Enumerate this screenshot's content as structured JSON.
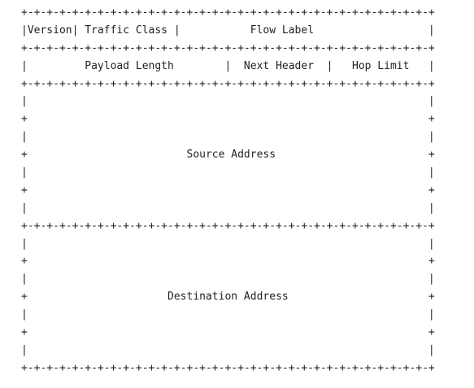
{
  "header_diagram": {
    "lines": [
      "+-+-+-+-+-+-+-+-+-+-+-+-+-+-+-+-+-+-+-+-+-+-+-+-+-+-+-+-+-+-+-+-+",
      "|Version| Traffic Class |           Flow Label                  |",
      "+-+-+-+-+-+-+-+-+-+-+-+-+-+-+-+-+-+-+-+-+-+-+-+-+-+-+-+-+-+-+-+-+",
      "|         Payload Length        |  Next Header  |   Hop Limit   |",
      "+-+-+-+-+-+-+-+-+-+-+-+-+-+-+-+-+-+-+-+-+-+-+-+-+-+-+-+-+-+-+-+-+",
      "|                                                               |",
      "+                                                               +",
      "|                                                               |",
      "+                         Source Address                        +",
      "|                                                               |",
      "+                                                               +",
      "|                                                               |",
      "+-+-+-+-+-+-+-+-+-+-+-+-+-+-+-+-+-+-+-+-+-+-+-+-+-+-+-+-+-+-+-+-+",
      "|                                                               |",
      "+                                                               +",
      "|                                                               |",
      "+                      Destination Address                      +",
      "|                                                               |",
      "+                                                               +",
      "|                                                               |",
      "+-+-+-+-+-+-+-+-+-+-+-+-+-+-+-+-+-+-+-+-+-+-+-+-+-+-+-+-+-+-+-+-+"
    ]
  }
}
